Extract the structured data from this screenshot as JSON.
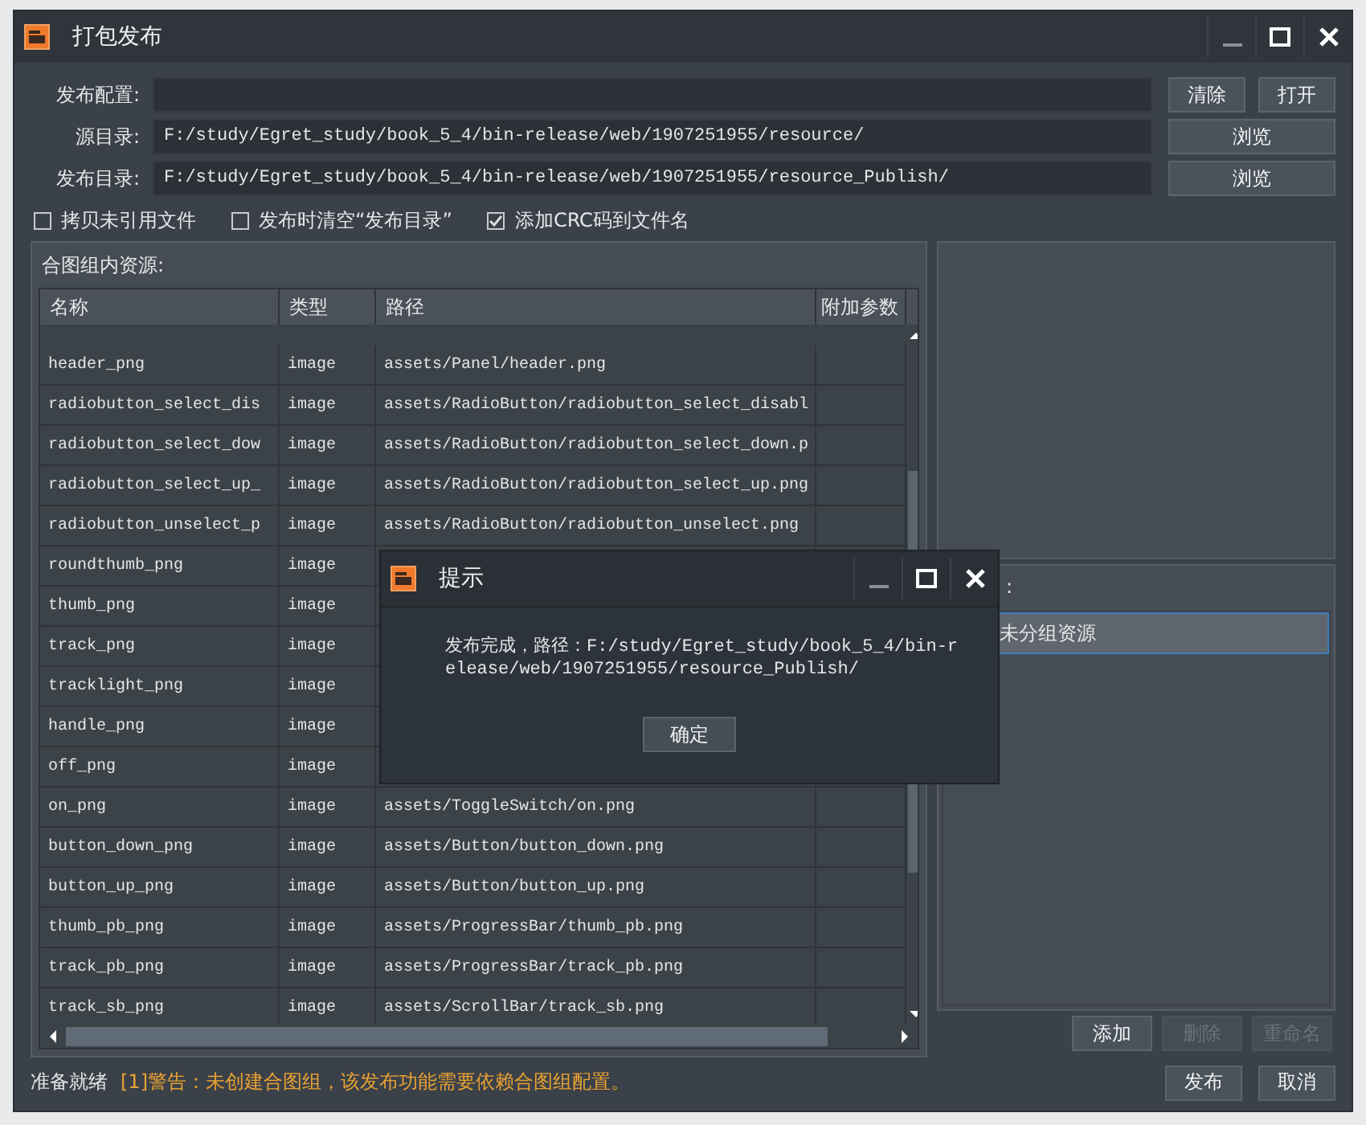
{
  "window": {
    "title": "打包发布"
  },
  "fields": [
    {
      "label": "发布配置:",
      "buttons": [
        {
          "label": "清除",
          "disabled": false
        },
        {
          "label": "打开",
          "disabled": false
        }
      ]
    },
    {
      "label": "源目录:",
      "value": "F:/study/Egret_study/book_5_4/bin-release/web/1907251955/resource/",
      "buttons": [
        {
          "label": "浏览",
          "disabled": false
        }
      ]
    },
    {
      "label": "发布目录:",
      "value": "F:/study/Egret_study/book_5_4/bin-release/web/1907251955/resource_Publish/",
      "buttons": [
        {
          "label": "浏览",
          "disabled": false
        }
      ]
    }
  ],
  "options": [
    {
      "label": "拷贝未引用文件",
      "checked": false
    },
    {
      "label": "发布时清空“发布目录”",
      "checked": false
    },
    {
      "label": "添加CRC码到文件名",
      "checked": true
    }
  ],
  "resources": {
    "title": "合图组内资源:",
    "columns": [
      "名称",
      "类型",
      "路径",
      "附加参数"
    ],
    "rows": [
      {
        "name": "header_png",
        "type": "image",
        "path": "assets/Panel/header.png"
      },
      {
        "name": "radiobutton_select_dis",
        "type": "image",
        "path": "assets/RadioButton/radiobutton_select_disabl"
      },
      {
        "name": "radiobutton_select_dow",
        "type": "image",
        "path": "assets/RadioButton/radiobutton_select_down.p"
      },
      {
        "name": "radiobutton_select_up_",
        "type": "image",
        "path": "assets/RadioButton/radiobutton_select_up.png"
      },
      {
        "name": "radiobutton_unselect_p",
        "type": "image",
        "path": "assets/RadioButton/radiobutton_unselect.png"
      },
      {
        "name": "roundthumb_png",
        "type": "image"
      },
      {
        "name": "thumb_png",
        "type": "image"
      },
      {
        "name": "track_png",
        "type": "image"
      },
      {
        "name": "tracklight_png",
        "type": "image"
      },
      {
        "name": "handle_png",
        "type": "image"
      },
      {
        "name": "off_png",
        "type": "image"
      },
      {
        "name": "on_png",
        "type": "image",
        "path": "assets/ToggleSwitch/on.png"
      },
      {
        "name": "button_down_png",
        "type": "image",
        "path": "assets/Button/button_down.png"
      },
      {
        "name": "button_up_png",
        "type": "image",
        "path": "assets/Button/button_up.png"
      },
      {
        "name": "thumb_pb_png",
        "type": "image",
        "path": "assets/ProgressBar/thumb_pb.png"
      },
      {
        "name": "track_pb_png",
        "type": "image",
        "path": "assets/ProgressBar/track_pb.png"
      },
      {
        "name": "track_sb_png",
        "type": "image",
        "path": "assets/ScrollBar/track_sb.png"
      }
    ]
  },
  "groups": {
    "label": ":",
    "items": [
      {
        "label": "未分组资源",
        "selected": true
      }
    ],
    "buttons": [
      {
        "label": "添加",
        "disabled": false
      },
      {
        "label": "删除",
        "disabled": true
      },
      {
        "label": "重命名",
        "disabled": true
      }
    ]
  },
  "status_bar": {
    "status": "准备就绪",
    "warning": "[1]警告：未创建合图组，该发布功能需要依赖合图组配置。"
  },
  "footer_buttons": [
    {
      "label": "发布",
      "disabled": false
    },
    {
      "label": "取消",
      "disabled": false
    }
  ],
  "dialog": {
    "title": "提示",
    "message": "发布完成，路径：F:/study/Egret_study/book_5_4/bin-release/web/1907251955/resource_Publish/",
    "button": "确定"
  }
}
